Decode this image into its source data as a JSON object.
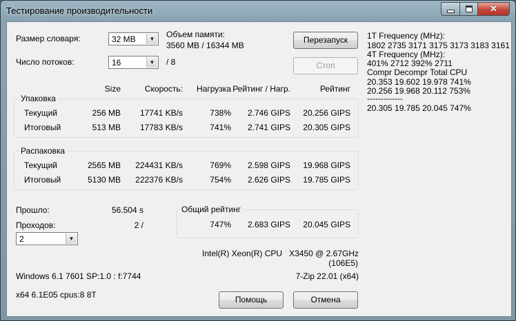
{
  "window": {
    "title": "Тестирование производительности"
  },
  "dict": {
    "label": "Размер словаря:",
    "value": "32 MB"
  },
  "threads": {
    "label": "Число потоков:",
    "value": "16",
    "suffix": "/ 8"
  },
  "memory": {
    "label": "Объем памяти:",
    "value": "3560 MB / 16344 MB"
  },
  "buttons": {
    "restart": "Перезапуск",
    "stop": "Стоп",
    "help": "Помощь",
    "cancel": "Отмена"
  },
  "headers": {
    "size": "Size",
    "speed": "Скорость:",
    "load": "Нагрузка",
    "rating_load": "Рейтинг / Нагр.",
    "rating": "Рейтинг"
  },
  "packing": {
    "title": "Упаковка",
    "rows": [
      {
        "label": "Текущий",
        "size": "256 MB",
        "speed": "17741 KB/s",
        "load": "738%",
        "rating_load": "2.746 GIPS",
        "rating": "20.256 GIPS"
      },
      {
        "label": "Итоговый",
        "size": "513 MB",
        "speed": "17783 KB/s",
        "load": "741%",
        "rating_load": "2.741 GIPS",
        "rating": "20.305 GIPS"
      }
    ]
  },
  "unpacking": {
    "title": "Распаковка",
    "rows": [
      {
        "label": "Текущий",
        "size": "2565 MB",
        "speed": "224431 KB/s",
        "load": "769%",
        "rating_load": "2.598 GIPS",
        "rating": "19.968 GIPS"
      },
      {
        "label": "Итоговый",
        "size": "5130 MB",
        "speed": "222376 KB/s",
        "load": "754%",
        "rating_load": "2.626 GIPS",
        "rating": "19.785 GIPS"
      }
    ]
  },
  "elapsed": {
    "label": "Прошло:",
    "value": "56.504 s"
  },
  "passes": {
    "label": "Проходов:",
    "value": "2 /",
    "select": "2"
  },
  "total": {
    "title": "Общий рейтинг",
    "load": "747%",
    "rating_load": "2.683 GIPS",
    "rating": "20.045 GIPS"
  },
  "cpu": {
    "name": "Intel(R) Xeon(R) CPU",
    "model": "X3450  @ 2.67GHz",
    "id": "(106E5)"
  },
  "os": {
    "info": "Windows 6.1 7601 SP:1.0 : f:7744",
    "sys": "x64 6.1E05 cpus:8 8T",
    "version": "7-Zip 22.01 (x64)"
  },
  "log": {
    "line1": "1T Frequency (MHz):",
    "line2": " 1802 2735 3171 3175 3173 3183 3161",
    "line3": "4T Frequency (MHz):",
    "line4": " 401% 2712 392% 2711",
    "line5": "Compr Decompr Total   CPU",
    "line6": "20.353  19.602  19.978   741%",
    "line7": "20.256  19.968  20.112   753%",
    "line8": "-------------",
    "line9": "20.305  19.785  20.045   747%"
  }
}
